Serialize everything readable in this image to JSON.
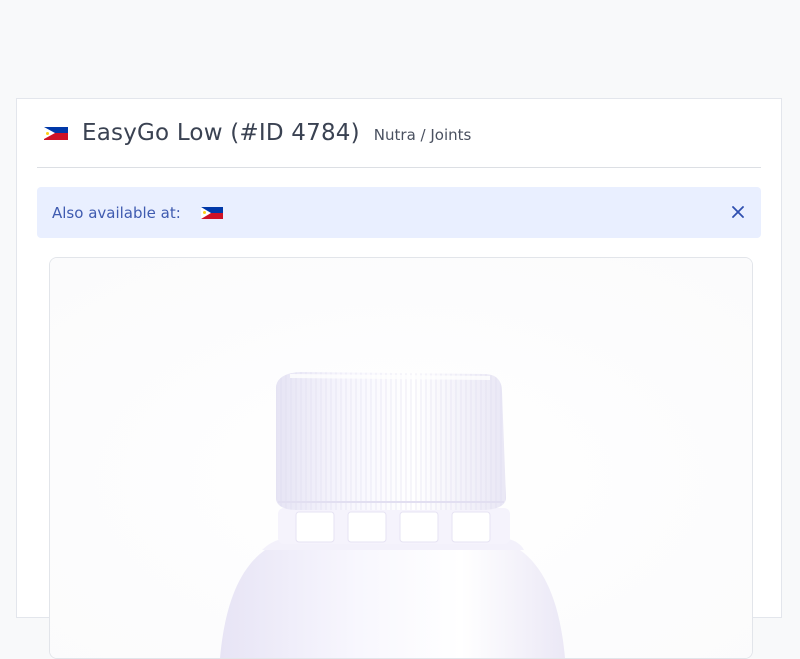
{
  "product": {
    "title": "EasyGo Low (#ID 4784)",
    "category": "Nutra / Joints",
    "country_flag_icon": "philippines-flag-icon"
  },
  "availability_alert": {
    "label": "Also available at:",
    "flag_icon": "philippines-flag-icon",
    "close_icon": "close-icon"
  },
  "product_image": {
    "icon": "white-supplement-bottle-image"
  },
  "colors": {
    "flag_blue": "#0038a8",
    "flag_red": "#ce1126",
    "flag_sun": "#fcd116",
    "alert_background": "#e9efff",
    "alert_text": "#3f5bb0",
    "close_icon": "#2f4fb0",
    "title_text": "#3a4252"
  }
}
